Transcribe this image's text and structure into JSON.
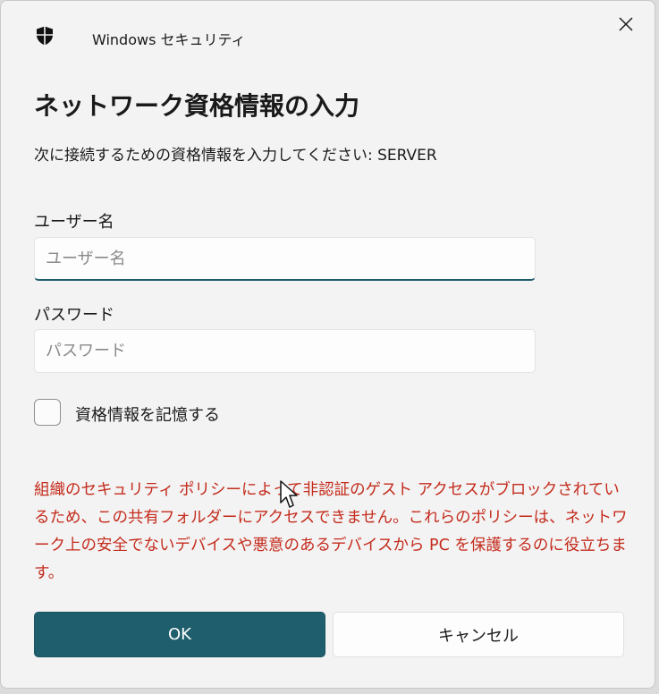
{
  "window": {
    "app_title": "Windows セキュリティ",
    "close_glyph": "✕"
  },
  "dialog": {
    "heading": "ネットワーク資格情報の入力",
    "subtext": "次に接続するための資格情報を入力してください: SERVER"
  },
  "form": {
    "username": {
      "label": "ユーザー名",
      "placeholder": "ユーザー名",
      "value": ""
    },
    "password": {
      "label": "パスワード",
      "placeholder": "パスワード",
      "value": ""
    },
    "remember": {
      "label": "資格情報を記憶する",
      "checked": false
    }
  },
  "warning": {
    "text": "組織のセキュリティ ポリシーによって非認証のゲスト アクセスがブロックされているため、この共有フォルダーにアクセスできません。これらのポリシーは、ネットワーク上の安全でないデバイスや悪意のあるデバイスから PC を保護するのに役立ちます。"
  },
  "buttons": {
    "ok_label": "OK",
    "cancel_label": "キャンセル"
  },
  "icons": {
    "app": "shield-icon",
    "close": "close-icon"
  },
  "colors": {
    "accent": "#1f5e6c",
    "warning": "#c42b1c"
  }
}
